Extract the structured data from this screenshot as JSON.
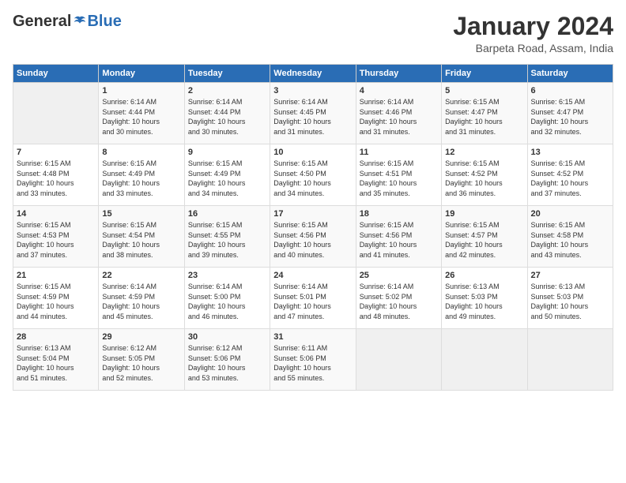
{
  "header": {
    "logo_general": "General",
    "logo_blue": "Blue",
    "month_title": "January 2024",
    "location": "Barpeta Road, Assam, India"
  },
  "days_of_week": [
    "Sunday",
    "Monday",
    "Tuesday",
    "Wednesday",
    "Thursday",
    "Friday",
    "Saturday"
  ],
  "weeks": [
    [
      {
        "day": "",
        "info": ""
      },
      {
        "day": "1",
        "info": "Sunrise: 6:14 AM\nSunset: 4:44 PM\nDaylight: 10 hours\nand 30 minutes."
      },
      {
        "day": "2",
        "info": "Sunrise: 6:14 AM\nSunset: 4:44 PM\nDaylight: 10 hours\nand 30 minutes."
      },
      {
        "day": "3",
        "info": "Sunrise: 6:14 AM\nSunset: 4:45 PM\nDaylight: 10 hours\nand 31 minutes."
      },
      {
        "day": "4",
        "info": "Sunrise: 6:14 AM\nSunset: 4:46 PM\nDaylight: 10 hours\nand 31 minutes."
      },
      {
        "day": "5",
        "info": "Sunrise: 6:15 AM\nSunset: 4:47 PM\nDaylight: 10 hours\nand 31 minutes."
      },
      {
        "day": "6",
        "info": "Sunrise: 6:15 AM\nSunset: 4:47 PM\nDaylight: 10 hours\nand 32 minutes."
      }
    ],
    [
      {
        "day": "7",
        "info": "Sunrise: 6:15 AM\nSunset: 4:48 PM\nDaylight: 10 hours\nand 33 minutes."
      },
      {
        "day": "8",
        "info": "Sunrise: 6:15 AM\nSunset: 4:49 PM\nDaylight: 10 hours\nand 33 minutes."
      },
      {
        "day": "9",
        "info": "Sunrise: 6:15 AM\nSunset: 4:49 PM\nDaylight: 10 hours\nand 34 minutes."
      },
      {
        "day": "10",
        "info": "Sunrise: 6:15 AM\nSunset: 4:50 PM\nDaylight: 10 hours\nand 34 minutes."
      },
      {
        "day": "11",
        "info": "Sunrise: 6:15 AM\nSunset: 4:51 PM\nDaylight: 10 hours\nand 35 minutes."
      },
      {
        "day": "12",
        "info": "Sunrise: 6:15 AM\nSunset: 4:52 PM\nDaylight: 10 hours\nand 36 minutes."
      },
      {
        "day": "13",
        "info": "Sunrise: 6:15 AM\nSunset: 4:52 PM\nDaylight: 10 hours\nand 37 minutes."
      }
    ],
    [
      {
        "day": "14",
        "info": "Sunrise: 6:15 AM\nSunset: 4:53 PM\nDaylight: 10 hours\nand 37 minutes."
      },
      {
        "day": "15",
        "info": "Sunrise: 6:15 AM\nSunset: 4:54 PM\nDaylight: 10 hours\nand 38 minutes."
      },
      {
        "day": "16",
        "info": "Sunrise: 6:15 AM\nSunset: 4:55 PM\nDaylight: 10 hours\nand 39 minutes."
      },
      {
        "day": "17",
        "info": "Sunrise: 6:15 AM\nSunset: 4:56 PM\nDaylight: 10 hours\nand 40 minutes."
      },
      {
        "day": "18",
        "info": "Sunrise: 6:15 AM\nSunset: 4:56 PM\nDaylight: 10 hours\nand 41 minutes."
      },
      {
        "day": "19",
        "info": "Sunrise: 6:15 AM\nSunset: 4:57 PM\nDaylight: 10 hours\nand 42 minutes."
      },
      {
        "day": "20",
        "info": "Sunrise: 6:15 AM\nSunset: 4:58 PM\nDaylight: 10 hours\nand 43 minutes."
      }
    ],
    [
      {
        "day": "21",
        "info": "Sunrise: 6:15 AM\nSunset: 4:59 PM\nDaylight: 10 hours\nand 44 minutes."
      },
      {
        "day": "22",
        "info": "Sunrise: 6:14 AM\nSunset: 4:59 PM\nDaylight: 10 hours\nand 45 minutes."
      },
      {
        "day": "23",
        "info": "Sunrise: 6:14 AM\nSunset: 5:00 PM\nDaylight: 10 hours\nand 46 minutes."
      },
      {
        "day": "24",
        "info": "Sunrise: 6:14 AM\nSunset: 5:01 PM\nDaylight: 10 hours\nand 47 minutes."
      },
      {
        "day": "25",
        "info": "Sunrise: 6:14 AM\nSunset: 5:02 PM\nDaylight: 10 hours\nand 48 minutes."
      },
      {
        "day": "26",
        "info": "Sunrise: 6:13 AM\nSunset: 5:03 PM\nDaylight: 10 hours\nand 49 minutes."
      },
      {
        "day": "27",
        "info": "Sunrise: 6:13 AM\nSunset: 5:03 PM\nDaylight: 10 hours\nand 50 minutes."
      }
    ],
    [
      {
        "day": "28",
        "info": "Sunrise: 6:13 AM\nSunset: 5:04 PM\nDaylight: 10 hours\nand 51 minutes."
      },
      {
        "day": "29",
        "info": "Sunrise: 6:12 AM\nSunset: 5:05 PM\nDaylight: 10 hours\nand 52 minutes."
      },
      {
        "day": "30",
        "info": "Sunrise: 6:12 AM\nSunset: 5:06 PM\nDaylight: 10 hours\nand 53 minutes."
      },
      {
        "day": "31",
        "info": "Sunrise: 6:11 AM\nSunset: 5:06 PM\nDaylight: 10 hours\nand 55 minutes."
      },
      {
        "day": "",
        "info": ""
      },
      {
        "day": "",
        "info": ""
      },
      {
        "day": "",
        "info": ""
      }
    ]
  ]
}
